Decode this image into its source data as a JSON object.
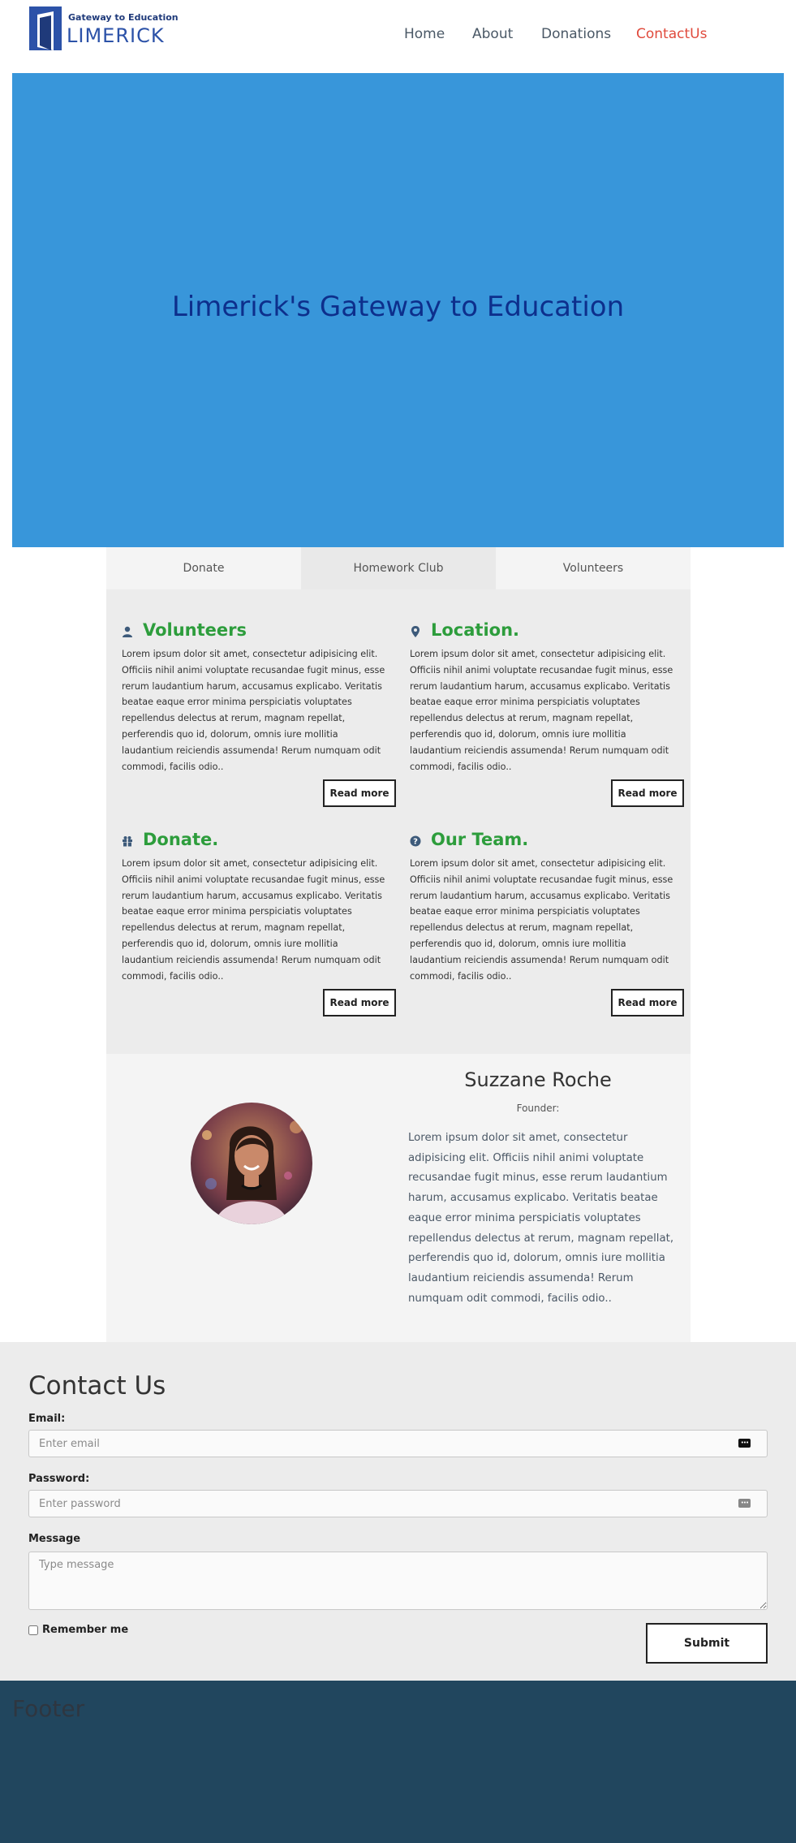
{
  "header": {
    "logo_top": "Gateway to Education",
    "logo_main": "LIMERICK",
    "nav": [
      {
        "label": "Home",
        "active": false
      },
      {
        "label": "About",
        "active": false
      },
      {
        "label": "Donations",
        "active": false
      },
      {
        "label": "ContactUs",
        "active": true
      }
    ]
  },
  "hero": {
    "title": "Limerick's Gateway to Education",
    "background": "#3896da"
  },
  "tabs": [
    {
      "label": "Donate",
      "active": false
    },
    {
      "label": "Homework Club",
      "active": true
    },
    {
      "label": "Volunteers",
      "active": false
    }
  ],
  "cards": [
    {
      "icon": "user-icon",
      "title": "Volunteers",
      "body": "Lorem ipsum dolor sit amet, consectetur adipisicing elit. Officiis nihil animi voluptate recusandae fugit minus, esse rerum laudantium harum, accusamus explicabo. Veritatis beatae eaque error minima perspiciatis voluptates repellendus delectus at rerum, magnam repellat, perferendis quo id, dolorum, omnis iure mollitia laudantium reiciendis assumenda! Rerum numquam odit commodi, facilis odio..",
      "button": "Read more"
    },
    {
      "icon": "map-marker-icon",
      "title": "Location.",
      "body": "Lorem ipsum dolor sit amet, consectetur adipisicing elit. Officiis nihil animi voluptate recusandae fugit minus, esse rerum laudantium harum, accusamus explicabo. Veritatis beatae eaque error minima perspiciatis voluptates repellendus delectus at rerum, magnam repellat, perferendis quo id, dolorum, omnis iure mollitia laudantium reiciendis assumenda! Rerum numquam odit commodi, facilis odio..",
      "button": "Read more"
    },
    {
      "icon": "gift-icon",
      "title": "Donate.",
      "body": "Lorem ipsum dolor sit amet, consectetur adipisicing elit. Officiis nihil animi voluptate recusandae fugit minus, esse rerum laudantium harum, accusamus explicabo. Veritatis beatae eaque error minima perspiciatis voluptates repellendus delectus at rerum, magnam repellat, perferendis quo id, dolorum, omnis iure mollitia laudantium reiciendis assumenda! Rerum numquam odit commodi, facilis odio..",
      "button": "Read more"
    },
    {
      "icon": "question-circle-icon",
      "title": "Our Team.",
      "body": "Lorem ipsum dolor sit amet, consectetur adipisicing elit. Officiis nihil animi voluptate recusandae fugit minus, esse rerum laudantium harum, accusamus explicabo. Veritatis beatae eaque error minima perspiciatis voluptates repellendus delectus at rerum, magnam repellat, perferendis quo id, dolorum, omnis iure mollitia laudantium reiciendis assumenda! Rerum numquam odit commodi, facilis odio..",
      "button": "Read more"
    }
  ],
  "profile": {
    "name": "Suzzane Roche",
    "role": "Founder:",
    "bio": "Lorem ipsum dolor sit amet, consectetur adipisicing elit. Officiis nihil animi voluptate recusandae fugit minus, esse rerum laudantium harum, accusamus explicabo. Veritatis beatae eaque error minima perspiciatis voluptates repellendus delectus at rerum, magnam repellat, perferendis quo id, dolorum, omnis iure mollitia laudantium reiciendis assumenda! Rerum numquam odit commodi, facilis odio.."
  },
  "contact": {
    "title": "Contact Us",
    "email_label": "Email:",
    "email_placeholder": "Enter email",
    "password_label": "Password:",
    "password_placeholder": "Enter password",
    "message_label": "Message",
    "message_placeholder": "Type message",
    "remember_label": "Remember me",
    "remember_checked": false,
    "submit_label": "Submit"
  },
  "footer": {
    "text": "Footer",
    "background": "#21465e"
  },
  "colors": {
    "accent_green": "#2d9d3c",
    "active_nav": "#e04a3c",
    "hero_title": "#0d2f8c"
  }
}
